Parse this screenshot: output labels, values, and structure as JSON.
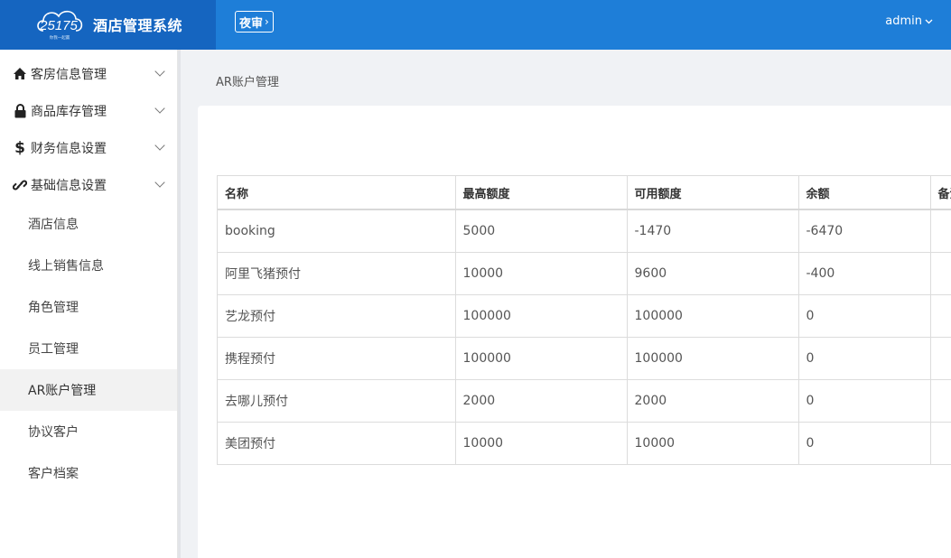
{
  "app": {
    "logo_number": "25175",
    "logo_tagline": "你我一起赢",
    "title": "酒店管理系统",
    "night_audit_label": "夜审",
    "user_label": "admin"
  },
  "sidebar": {
    "groups": [
      {
        "label": "客房信息管理",
        "icon": "home-icon"
      },
      {
        "label": "商品库存管理",
        "icon": "lock-icon"
      },
      {
        "label": "财务信息设置",
        "icon": "dollar-icon"
      },
      {
        "label": "基础信息设置",
        "icon": "link-icon"
      }
    ],
    "sub_items": [
      {
        "label": "酒店信息"
      },
      {
        "label": "线上销售信息"
      },
      {
        "label": "角色管理"
      },
      {
        "label": "员工管理"
      },
      {
        "label": "AR账户管理",
        "active": true
      },
      {
        "label": "协议客户"
      },
      {
        "label": "客户档案"
      }
    ]
  },
  "breadcrumb": "AR账户管理",
  "table": {
    "headers": [
      "名称",
      "最高额度",
      "可用额度",
      "余额",
      "备注"
    ],
    "rows": [
      [
        "booking",
        "5000",
        "-1470",
        "-6470",
        ""
      ],
      [
        "阿里飞猪预付",
        "10000",
        "9600",
        "-400",
        ""
      ],
      [
        "艺龙预付",
        "100000",
        "100000",
        "0",
        ""
      ],
      [
        "携程预付",
        "100000",
        "100000",
        "0",
        ""
      ],
      [
        "去哪儿预付",
        "2000",
        "2000",
        "0",
        ""
      ],
      [
        "美团预付",
        "10000",
        "10000",
        "0",
        ""
      ]
    ]
  },
  "colors": {
    "header_bg": "#1e7ed8",
    "logo_bg": "#1565c0",
    "active_item_bg": "#f2f2f2"
  }
}
